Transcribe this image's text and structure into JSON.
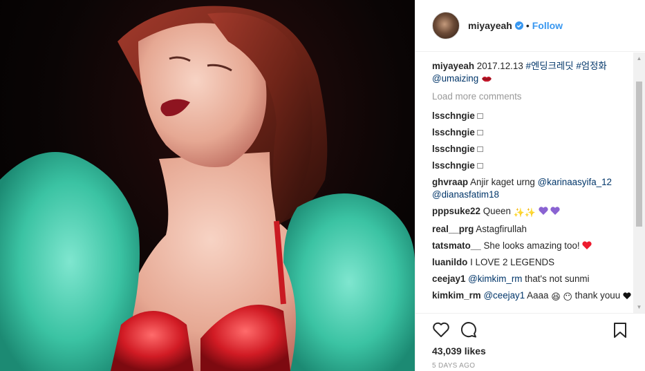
{
  "header": {
    "username": "miyayeah",
    "separator": "•",
    "follow_label": "Follow",
    "verified_icon": "verified-badge-icon"
  },
  "caption": {
    "user": "miyayeah",
    "text_prefix": "2017.12.13 ",
    "hashtag1": "#엔딩크레딧",
    "hashtag2": "#엄정화",
    "mention": "@umaizing"
  },
  "load_more": "Load more comments",
  "comments": [
    {
      "user": "lsschngie",
      "pre": "",
      "mention": "",
      "post": "□"
    },
    {
      "user": "lsschngie",
      "pre": "",
      "mention": "",
      "post": "□"
    },
    {
      "user": "lsschngie",
      "pre": "",
      "mention": "",
      "post": "□"
    },
    {
      "user": "lsschngie",
      "pre": "",
      "mention": "",
      "post": "□"
    },
    {
      "user": "ghvraap",
      "pre": "Anjir kaget urng ",
      "mention": "@karinaasyifa_12 @dianasfatim18",
      "post": ""
    },
    {
      "user": "pppsuke22",
      "pre": "Queen ",
      "mention": "",
      "post": ""
    },
    {
      "user": "real__prg",
      "pre": "Astagfirullah",
      "mention": "",
      "post": ""
    },
    {
      "user": "tatsmato__",
      "pre": "She looks amazing too! ",
      "mention": "",
      "post": ""
    },
    {
      "user": "luanildo",
      "pre": "I LOVE 2 LEGENDS",
      "mention": "",
      "post": ""
    },
    {
      "user": "ceejay1",
      "pre": "",
      "mention": "@kimkim_rm",
      "post": " that's not sunmi"
    },
    {
      "user": "kimkim_rm",
      "pre": "",
      "mention": "@ceejay1",
      "post": " Aaaa"
    },
    {
      "user": "",
      "pre": "thank youu",
      "mention": "",
      "post": ""
    }
  ],
  "actions": {
    "likes": "43,039 likes",
    "time_ago": "5 DAYS AGO"
  },
  "colors": {
    "link": "#3897f0",
    "mention": "#003569",
    "fur": "#3fc7a8",
    "lips": "#8e1420",
    "heart_red": "#ed1b2e",
    "purple_heart": "#8a63d2"
  }
}
